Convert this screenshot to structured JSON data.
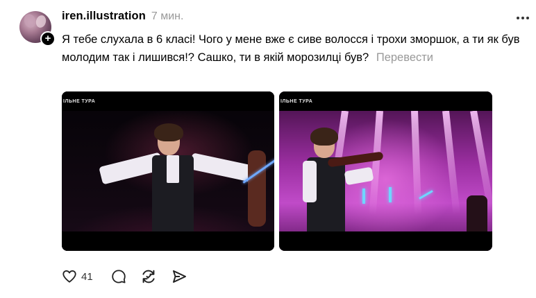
{
  "post": {
    "username": "iren.illustration",
    "time": "7 мин.",
    "text": "Я тебе слухала в 6 класі! Чого у мене вже є сиве волосся і трохи зморшок, а ти як був молодим так і лишився!? Сашко, ти в якій морозилці був?",
    "translate_label": "Перевести",
    "media": [
      {
        "kind": "video-frame",
        "logo_text": "ІЛЬНЕ ТУРА"
      },
      {
        "kind": "video-frame",
        "logo_text": "ІЛЬНЕ ТУРА"
      }
    ]
  },
  "actions": {
    "like_count": "41",
    "icons": [
      "heart-icon",
      "comment-icon",
      "repost-icon",
      "share-icon"
    ]
  },
  "colors": {
    "text": "#000000",
    "muted": "#999999"
  }
}
